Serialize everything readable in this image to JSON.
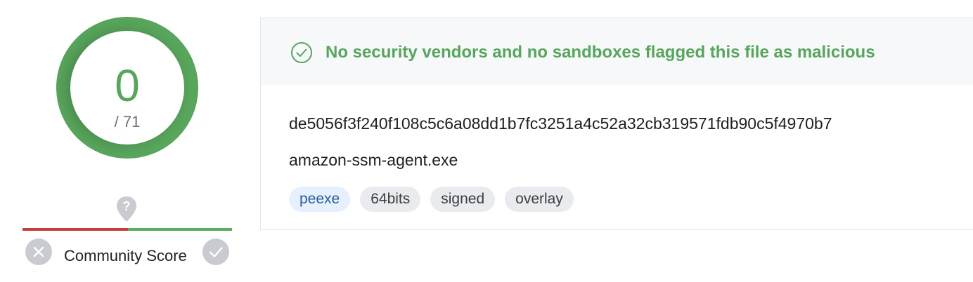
{
  "score": {
    "value": "0",
    "total": "/ 71"
  },
  "community": {
    "label": "Community Score",
    "unknown_icon": "question-pin-icon",
    "bad_icon": "x-icon",
    "good_icon": "check-icon"
  },
  "status": {
    "icon": "check-circle-icon",
    "text": "No security vendors and no sandboxes flagged this file as malicious"
  },
  "file": {
    "hash": "de5056f3f240f108c5c6a08dd1b7fc3251a4c52a32cb319571fdb90c5f4970b7",
    "name": "amazon-ssm-agent.exe",
    "tags": [
      "peexe",
      "64bits",
      "signed",
      "overlay"
    ]
  },
  "colors": {
    "clean": "#58a55c",
    "malicious": "#c53e3a",
    "tag_primary_bg": "#e6f1fd"
  }
}
